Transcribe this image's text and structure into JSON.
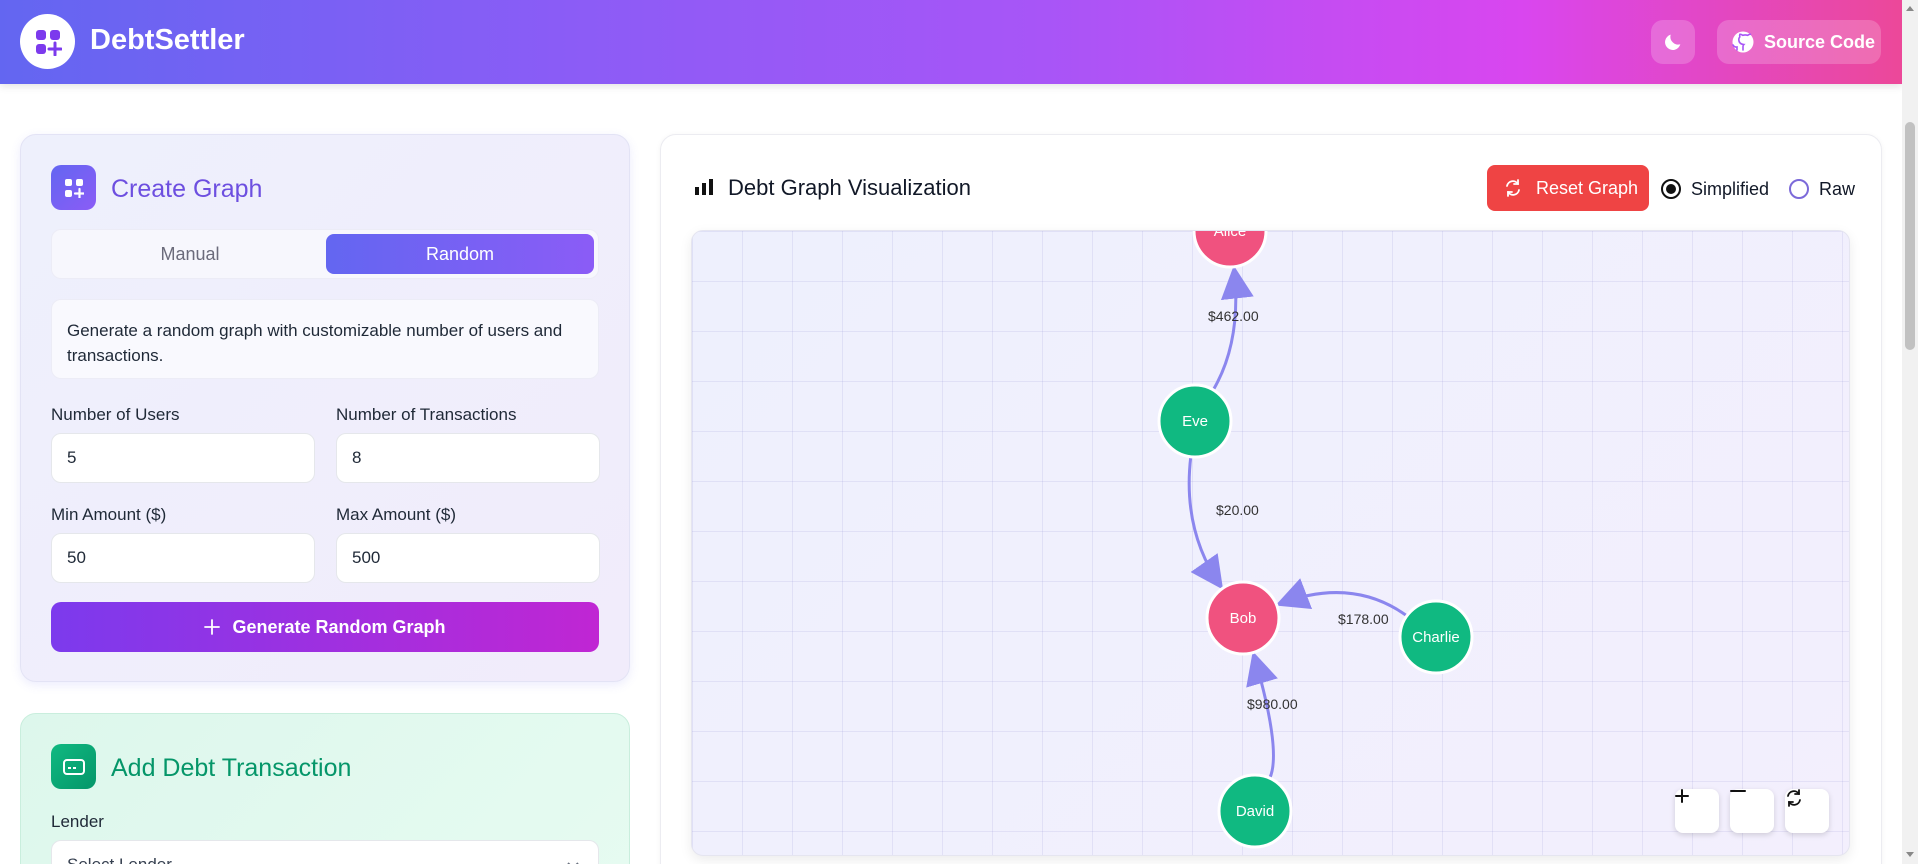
{
  "header": {
    "brand": "DebtSettler",
    "source_label": "Source Code"
  },
  "create_graph": {
    "title": "Create Graph",
    "tabs": [
      "Manual",
      "Random"
    ],
    "active_tab": "Random",
    "description": "Generate a random graph with customizable number of users and transactions.",
    "fields": {
      "num_users": {
        "label": "Number of Users",
        "value": "5"
      },
      "num_transactions": {
        "label": "Number of Transactions",
        "value": "8"
      },
      "min_amount": {
        "label": "Min Amount ($)",
        "value": "50"
      },
      "max_amount": {
        "label": "Max Amount ($)",
        "value": "500"
      }
    },
    "generate_label": "Generate Random Graph"
  },
  "add_debt": {
    "title": "Add Debt Transaction",
    "lender_label": "Lender",
    "lender_placeholder": "Select Lender"
  },
  "visualization": {
    "title": "Debt Graph Visualization",
    "reset_label": "Reset Graph",
    "mode_options": [
      "Simplified",
      "Raw"
    ],
    "selected_mode": "Simplified"
  },
  "graph": {
    "nodes": [
      {
        "id": "Alice",
        "label": "Alice",
        "role": "creditor"
      },
      {
        "id": "Eve",
        "label": "Eve",
        "role": "debtor"
      },
      {
        "id": "Bob",
        "label": "Bob",
        "role": "creditor"
      },
      {
        "id": "Charlie",
        "label": "Charlie",
        "role": "debtor"
      },
      {
        "id": "David",
        "label": "David",
        "role": "debtor"
      }
    ],
    "edges": [
      {
        "from": "Eve",
        "to": "Alice",
        "amount": "$462.00"
      },
      {
        "from": "Eve",
        "to": "Bob",
        "amount": "$20.00"
      },
      {
        "from": "Charlie",
        "to": "Bob",
        "amount": "$178.00"
      },
      {
        "from": "David",
        "to": "Bob",
        "amount": "$980.00"
      }
    ],
    "colors": {
      "creditor": "#f0527f",
      "debtor": "#10b981",
      "edge": "#8b86ee"
    }
  }
}
